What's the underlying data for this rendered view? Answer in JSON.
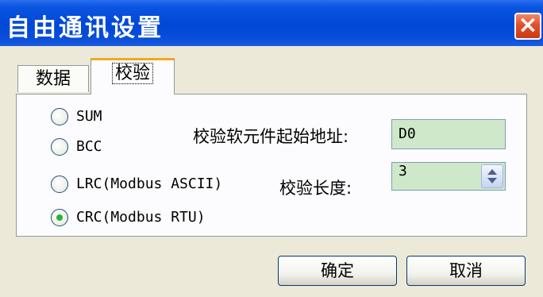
{
  "window": {
    "title": "自由通讯设置",
    "close_icon": "×"
  },
  "tabs": [
    {
      "label": "数据",
      "active": false
    },
    {
      "label": "校验",
      "active": true
    }
  ],
  "radio_options": [
    {
      "label": "SUM",
      "checked": false
    },
    {
      "label": "BCC",
      "checked": false
    },
    {
      "label": "LRC(Modbus ASCII)",
      "checked": false
    },
    {
      "label": "CRC(Modbus RTU)",
      "checked": true
    }
  ],
  "fields": {
    "start_address": {
      "label": "校验软元件起始地址:",
      "value": "D0"
    },
    "length": {
      "label": "校验长度:",
      "value": "3"
    }
  },
  "buttons": {
    "ok": "确定",
    "cancel": "取消"
  },
  "colors": {
    "titlebar": "#0047d8",
    "field_bg": "#cfe8c9",
    "active_tab_accent": "#f5a623",
    "radio_dot": "#24b636"
  }
}
